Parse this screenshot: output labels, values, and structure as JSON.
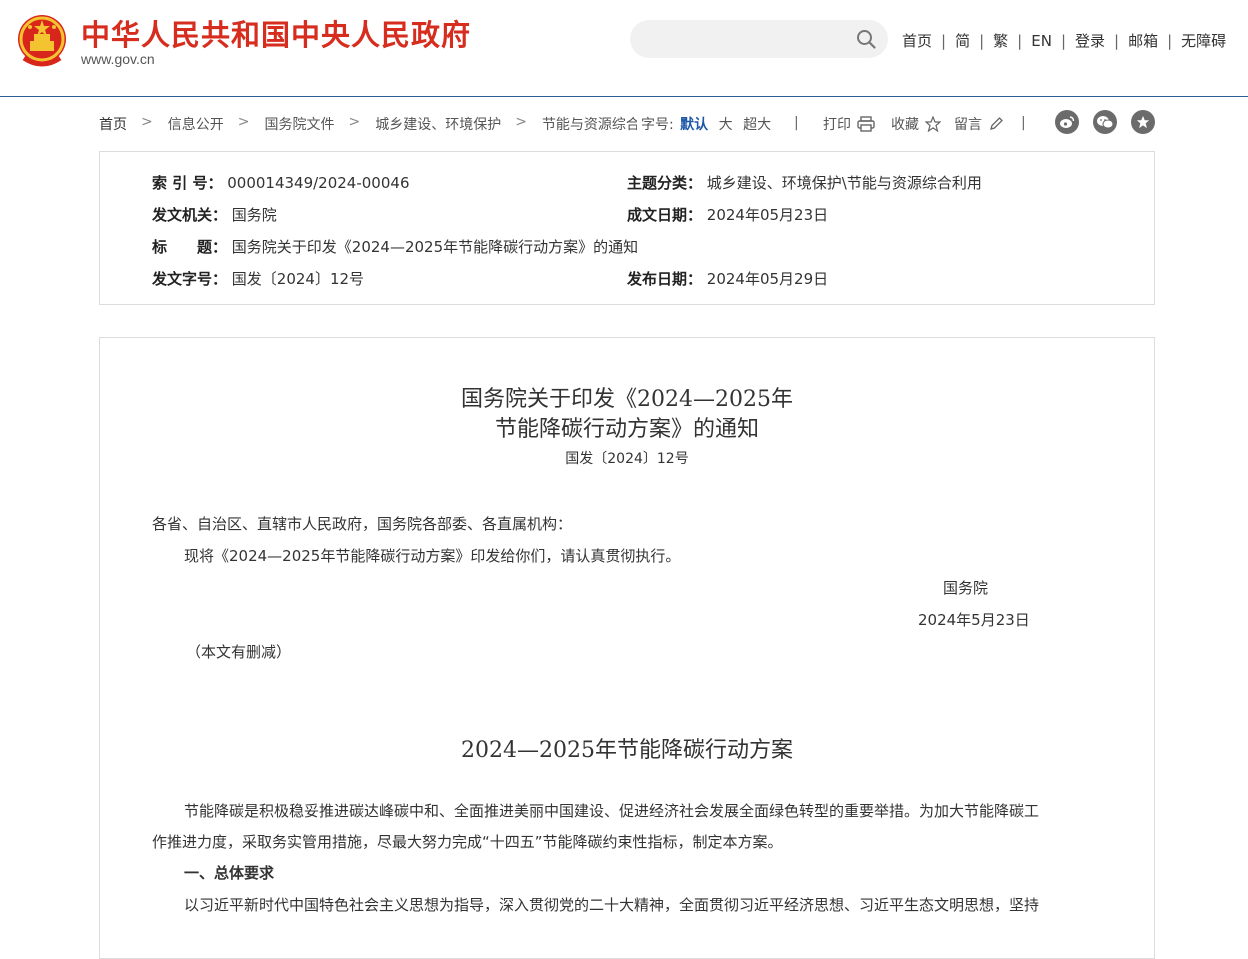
{
  "header": {
    "site_title": "中华人民共和国中央人民政府",
    "site_domain": "www.gov.cn",
    "nav": [
      "首页",
      "简",
      "繁",
      "EN",
      "登录",
      "邮箱",
      "无障碍"
    ],
    "nav_separator": "|"
  },
  "search": {
    "placeholder": "",
    "value": ""
  },
  "breadcrumb": {
    "items": [
      "首页",
      "信息公开",
      "国务院文件",
      "城乡建设、环境保护",
      "节能与资源综合利用"
    ],
    "separator": ">"
  },
  "toolbar": {
    "font_size_label": "字号:",
    "font_sizes": [
      "默认",
      "大",
      "超大"
    ],
    "active_font_size": "默认",
    "print_label": "打印",
    "favorite_label": "收藏",
    "comment_label": "留言",
    "divider": "|"
  },
  "share_icons": [
    "weibo-icon",
    "wechat-icon",
    "star-icon"
  ],
  "metadata": {
    "index_no_label": "索 引 号：",
    "index_no": "000014349/2024-00046",
    "category_label": "主题分类：",
    "category": "城乡建设、环境保护\\节能与资源综合利用",
    "issuer_label": "发文机关：",
    "issuer": "国务院",
    "written_date_label": "成文日期：",
    "written_date": "2024年05月23日",
    "title_label": "标　　题：",
    "title": "国务院关于印发《2024—2025年节能降碳行动方案》的通知",
    "doc_no_label": "发文字号：",
    "doc_no": "国发〔2024〕12号",
    "publish_date_label": "发布日期：",
    "publish_date": "2024年05月29日"
  },
  "article": {
    "title_line1": "国务院关于印发《2024—2025年",
    "title_line2": "节能降碳行动方案》的通知",
    "doc_no": "国发〔2024〕12号",
    "addressee": "各省、自治区、直辖市人民政府，国务院各部委、各直属机构：",
    "body": "现将《2024—2025年节能降碳行动方案》印发给你们，请认真贯彻执行。",
    "signature": "国务院",
    "date": "2024年5月23日",
    "note": "（本文有删减）",
    "plan_title": "2024—2025年节能降碳行动方案",
    "para1_line1": "节能降碳是积极稳妥推进碳达峰碳中和、全面推进美丽中国建设、促进经济社会发展全面绿色转型的重要举措。为加大节能降碳工",
    "para1_line2": "作推进力度，采取务实管用措施，尽最大努力完成“十四五”节能降碳约束性指标，制定本方案。",
    "section1_heading": "一、总体要求",
    "para2_line1": "以习近平新时代中国特色社会主义思想为指导，深入贯彻党的二十大精神，全面贯彻习近平经济思想、习近平生态文明思想，坚持"
  },
  "colors": {
    "brand_red": "#d62d1f",
    "header_rule": "#2e5c94",
    "active_link": "#1d58a8",
    "icon_gray": "#6b6b6b"
  }
}
